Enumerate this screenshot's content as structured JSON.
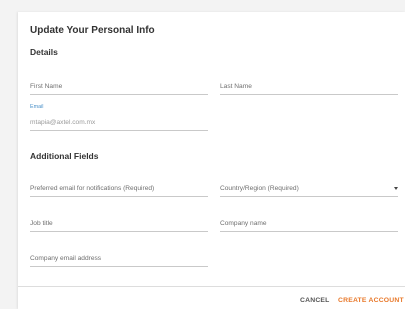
{
  "dialog": {
    "title": "Update Your Personal Info"
  },
  "details": {
    "heading": "Details",
    "first_name_placeholder": "First Name",
    "last_name_placeholder": "Last Name",
    "email_label": "Email",
    "email_value": "mtapia@axtel.com.mx"
  },
  "additional": {
    "heading": "Additional Fields",
    "preferred_email_placeholder": "Preferred email for notifications (Required)",
    "country_placeholder": "Country/Region (Required)",
    "job_title_placeholder": "Job title",
    "company_name_placeholder": "Company name",
    "company_email_placeholder": "Company email address"
  },
  "footer": {
    "cancel_label": "CANCEL",
    "create_label": "CREATE ACCOUNT"
  },
  "colors": {
    "accent": "#e8782a",
    "cancel": "#555555",
    "float_label": "#4a90c8"
  },
  "icons": {
    "dropdown": "caret-down-icon"
  }
}
